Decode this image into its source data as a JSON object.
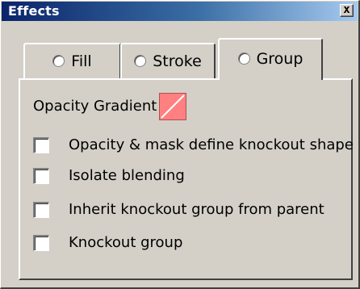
{
  "window": {
    "title": "Effects",
    "close_glyph": "x"
  },
  "tabs": [
    {
      "label": "Fill",
      "selected": false
    },
    {
      "label": "Stroke",
      "selected": false
    },
    {
      "label": "Group",
      "selected": true
    }
  ],
  "group_panel": {
    "opacity_gradient_label": "Opacity Gradient",
    "opacity_gradient_swatch": {
      "color": "#ff8080",
      "icon": "none-slash-swatch"
    },
    "checkboxes": [
      {
        "label": "Opacity & mask define knockout shape",
        "checked": false
      },
      {
        "label": "Isolate blending",
        "checked": false
      },
      {
        "label": "Inherit knockout group from parent",
        "checked": false
      },
      {
        "label": "Knockout group",
        "checked": false
      }
    ]
  },
  "colors": {
    "title_gradient_start": "#0a246a",
    "title_gradient_end": "#a6caf0",
    "face": "#d4d0c8"
  }
}
